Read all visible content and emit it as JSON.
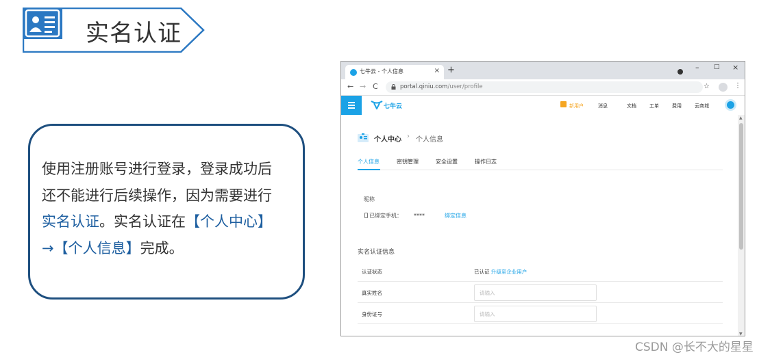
{
  "header": {
    "title": "实名认证",
    "icon": "id-card-icon",
    "accent": "#2b78c2"
  },
  "description": {
    "line1": "使用注册账号进行登录，登录成功后",
    "line2": "还不能进行后续操作，因为需要进行",
    "line3_hl": "实名认证",
    "line3_rest": "。实名认证在",
    "line3_hl2": "【个人中心】",
    "line4_hl": "→【个人信息】",
    "line4_rest": "完成。",
    "highlight_color": "#1e5fa0"
  },
  "browser": {
    "tab_title": "七牛云 - 个人信息",
    "tab_close": "×",
    "new_tab": "+",
    "window_buttons": {
      "minimize": "–",
      "maximize": "□",
      "close": "×"
    },
    "nav": {
      "back": "←",
      "forward": "→",
      "reload": "C"
    },
    "url_host": "portal.qiniu.com",
    "url_path": "/user/profile",
    "bookmark": "☆",
    "menu": "⋮"
  },
  "app": {
    "logo_text": "七牛云",
    "nav": {
      "new_user": "新用户",
      "messages": "消息",
      "docs": "文档",
      "tickets": "工单",
      "billing": "费用",
      "market": "云商城"
    },
    "accent": "#1ba2e6"
  },
  "profile": {
    "breadcrumb_main": "个人中心",
    "breadcrumb_sep": "›",
    "breadcrumb_sub": "个人信息",
    "tabs": [
      "个人信息",
      "密钥管理",
      "安全设置",
      "操作日志"
    ],
    "nickname_label": "昵称",
    "phone_label": "已绑定手机：",
    "phone_value": "****",
    "phone_link": "绑定信息",
    "section_title": "实名认证信息",
    "rows": {
      "status_label": "认证状态",
      "status_value": "已认证",
      "status_link": "升级至企业用户",
      "name_label": "真实姓名",
      "name_placeholder": "请输入",
      "id_label": "身份证号",
      "id_placeholder": "请输入"
    }
  },
  "watermark": "CSDN @长不大的星星"
}
